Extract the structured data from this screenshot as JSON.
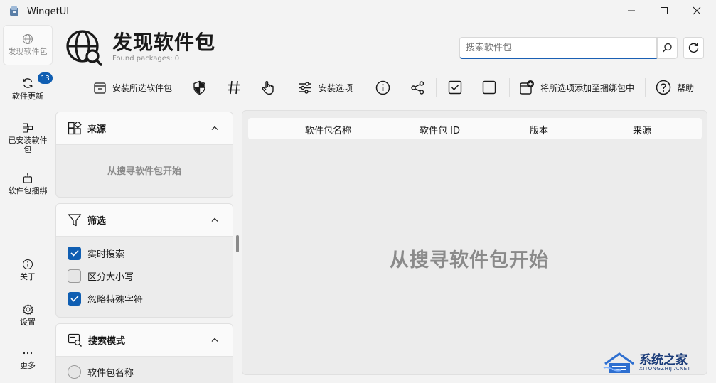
{
  "window": {
    "title": "WingetUI"
  },
  "nav": {
    "items": [
      {
        "label": "发现软件包",
        "icon": "globe-icon",
        "active": true
      },
      {
        "label": "软件更新",
        "icon": "refresh-icon",
        "badge": "13"
      },
      {
        "label": "已安装软件包",
        "icon": "installed-packages-icon"
      },
      {
        "label": "软件包捆绑",
        "icon": "bundle-icon"
      }
    ],
    "bottom": [
      {
        "label": "关于",
        "icon": "info-icon"
      },
      {
        "label": "设置",
        "icon": "gear-icon"
      },
      {
        "label": "更多",
        "icon": "more-icon"
      }
    ]
  },
  "header": {
    "title": "发现软件包",
    "subtitle": "Found packages: 0",
    "search_placeholder": "搜索软件包"
  },
  "toolbar": {
    "install_selected": "安装所选软件包",
    "install_options": "安装选项",
    "add_to_bundle": "将所选项添加至捆绑包中",
    "help": "帮助"
  },
  "panels": {
    "sources": {
      "title": "来源",
      "empty_text": "从搜寻软件包开始"
    },
    "filters": {
      "title": "筛选",
      "options": [
        {
          "label": "实时搜索",
          "checked": true
        },
        {
          "label": "区分大小写",
          "checked": false
        },
        {
          "label": "忽略特殊字符",
          "checked": true
        }
      ]
    },
    "search_mode": {
      "title": "搜索模式",
      "first_option": "软件包名称"
    }
  },
  "table": {
    "columns": [
      "软件包名称",
      "软件包 ID",
      "版本",
      "来源"
    ],
    "empty_text": "从搜寻软件包开始"
  },
  "watermark": {
    "text": "系统之家",
    "sub": "XITONGZHIJIA.NET"
  },
  "colors": {
    "accent": "#0f5eb2",
    "background": "#f3f3f3"
  }
}
